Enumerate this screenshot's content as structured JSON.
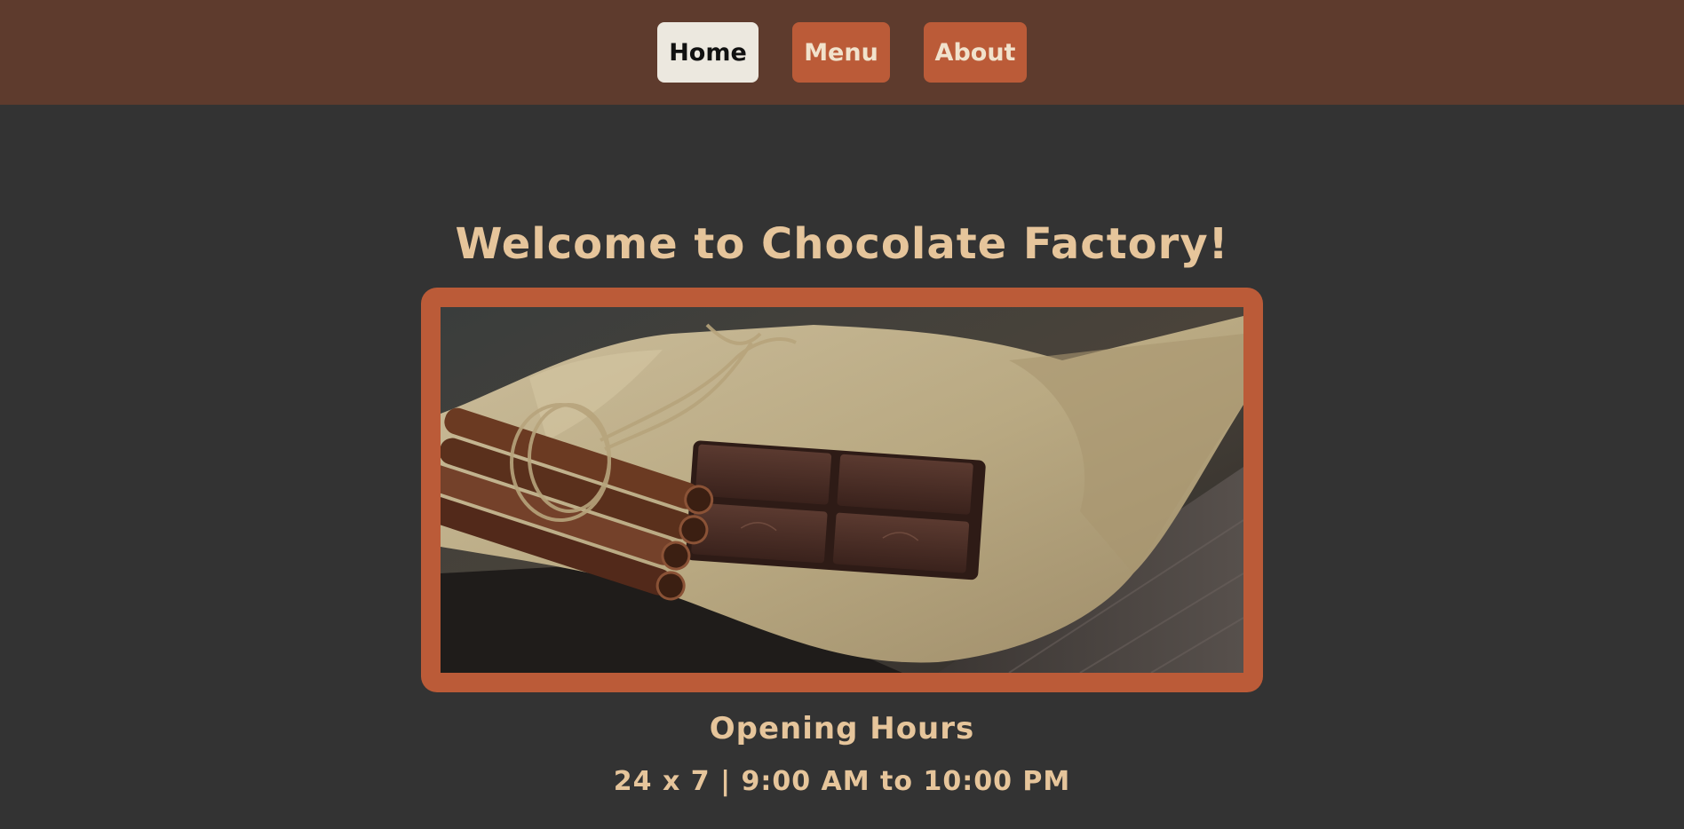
{
  "nav": {
    "items": [
      {
        "label": "Home",
        "active": true
      },
      {
        "label": "Menu",
        "active": false
      },
      {
        "label": "About",
        "active": false
      }
    ]
  },
  "hero": {
    "title": "Welcome to Chocolate Factory!",
    "image_icon": "chocolate-cinnamon-photo"
  },
  "hours": {
    "heading": "Opening Hours",
    "text": "24 x 7 | 9:00 AM to 10:00 PM"
  },
  "colors": {
    "topbar": "#5e3b2d",
    "background": "#333333",
    "accent": "#bb5b38",
    "active_button": "#ece8df",
    "heading_text": "#e6c59b"
  }
}
